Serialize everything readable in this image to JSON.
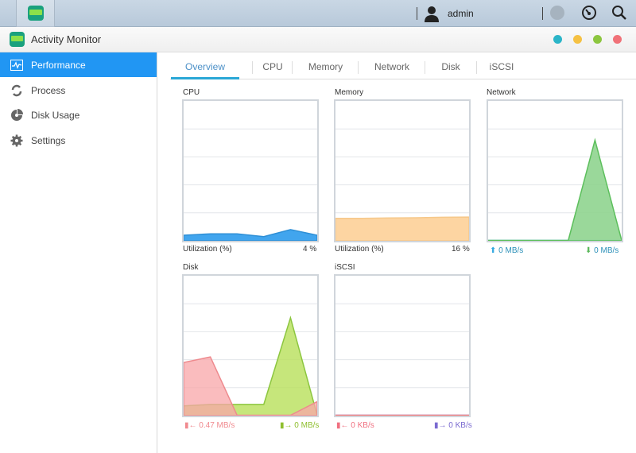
{
  "topbar": {
    "user_name": "admin",
    "icons": [
      "activity-monitor-app-icon",
      "user-icon",
      "notification-icon",
      "dashboard-icon",
      "search-icon"
    ]
  },
  "window": {
    "title": "Activity Monitor",
    "controls": [
      {
        "name": "help",
        "color": "#2bb5c8"
      },
      {
        "name": "minimize",
        "color": "#f5c143"
      },
      {
        "name": "maximize",
        "color": "#8cc63f"
      },
      {
        "name": "close",
        "color": "#f07178"
      }
    ]
  },
  "sidebar": {
    "items": [
      {
        "label": "Performance",
        "icon": "performance-icon",
        "active": true
      },
      {
        "label": "Process",
        "icon": "process-icon",
        "active": false
      },
      {
        "label": "Disk Usage",
        "icon": "disk-usage-icon",
        "active": false
      },
      {
        "label": "Settings",
        "icon": "settings-icon",
        "active": false
      }
    ]
  },
  "tabs": [
    {
      "label": "Overview",
      "active": true
    },
    {
      "label": "CPU",
      "active": false
    },
    {
      "label": "Memory",
      "active": false
    },
    {
      "label": "Network",
      "active": false
    },
    {
      "label": "Disk",
      "active": false
    },
    {
      "label": "iSCSI",
      "active": false
    }
  ],
  "panels": {
    "cpu": {
      "title": "CPU",
      "footer_label": "Utilization (%)",
      "footer_value": "4 %"
    },
    "memory": {
      "title": "Memory",
      "footer_label": "Utilization (%)",
      "footer_value": "16 %"
    },
    "network": {
      "title": "Network",
      "upload": "0 MB/s",
      "download": "0 MB/s"
    },
    "disk": {
      "title": "Disk",
      "read": "0.47 MB/s",
      "write": "0 MB/s"
    },
    "iscsi": {
      "title": "iSCSI",
      "read": "0 KB/s",
      "write": "0 KB/s"
    }
  },
  "colors": {
    "accent": "#2196f3",
    "cpu": "#2e9be6",
    "memory": "#fdd5a2",
    "network": "#8fd48f",
    "disk_read": "#f8a5a8",
    "disk_write": "#b8e05a",
    "iscsi_read": "#f08080",
    "iscsi_write": "#6a5acd"
  },
  "chart_data": [
    {
      "type": "area",
      "title": "CPU",
      "ylim": [
        0,
        100
      ],
      "series": [
        {
          "name": "Utilization (%)",
          "values": [
            4,
            5,
            5,
            3,
            8,
            4
          ]
        }
      ]
    },
    {
      "type": "area",
      "title": "Memory",
      "ylim": [
        0,
        100
      ],
      "series": [
        {
          "name": "Utilization (%)",
          "values": [
            16,
            16,
            16.3,
            16.5,
            16.8,
            17
          ]
        }
      ]
    },
    {
      "type": "area",
      "title": "Network",
      "ylim": [
        0,
        100
      ],
      "series": [
        {
          "name": "Download",
          "values": [
            0,
            0,
            0,
            0,
            72,
            0
          ]
        },
        {
          "name": "Upload",
          "values": [
            0,
            0,
            0,
            0,
            0,
            0
          ]
        }
      ]
    },
    {
      "type": "area",
      "title": "Disk",
      "ylim": [
        0,
        100
      ],
      "series": [
        {
          "name": "Read",
          "values": [
            38,
            42,
            0,
            0,
            0,
            10
          ]
        },
        {
          "name": "Write",
          "values": [
            7,
            8,
            8,
            8,
            70,
            0
          ]
        }
      ]
    },
    {
      "type": "area",
      "title": "iSCSI",
      "ylim": [
        0,
        100
      ],
      "series": [
        {
          "name": "Read",
          "values": [
            0,
            0,
            0,
            0,
            0,
            0
          ]
        },
        {
          "name": "Write",
          "values": [
            0,
            0,
            0,
            0,
            0,
            0
          ]
        }
      ]
    }
  ]
}
